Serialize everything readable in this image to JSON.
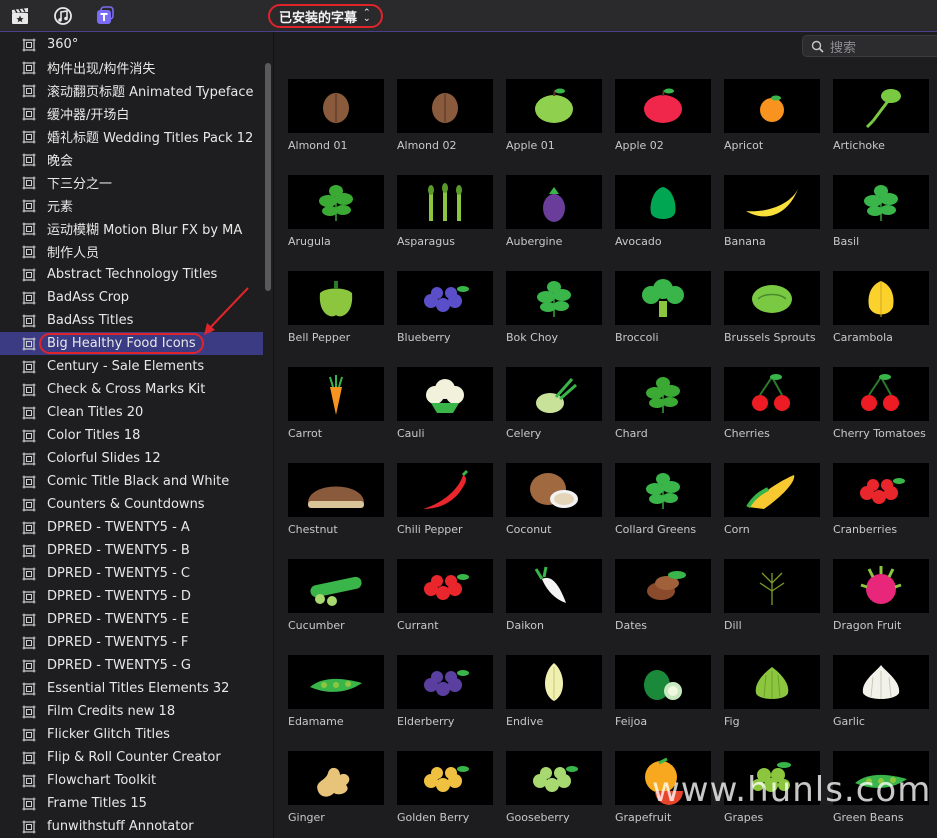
{
  "toolbar": {
    "icons": [
      "clapper-star-icon",
      "music-notes-icon",
      "titles-icon"
    ],
    "dropdown_label": "已安装的字幕",
    "accent": "#4a3f8a",
    "highlight_color": "#e0242a"
  },
  "search": {
    "placeholder": "搜索"
  },
  "sidebar": {
    "selected_index": 13,
    "items": [
      "360°",
      "构件出现/构件消失",
      "滚动翻页标题 Animated Typeface",
      "缓冲器/开场白",
      "婚礼标题 Wedding Titles Pack 12",
      "晚会",
      "下三分之一",
      "元素",
      "运动模糊 Motion Blur FX by MA",
      "制作人员",
      "Abstract Technology Titles",
      "BadAss Crop",
      "BadAss Titles",
      "Big Healthy Food Icons",
      "Century - Sale Elements",
      "Check & Cross Marks Kit",
      "Clean Titles 20",
      "Color Titles 18",
      "Colorful Slides 12",
      "Comic Title Black and White",
      "Counters & Countdowns",
      "DPRED - TWENTY5 - A",
      "DPRED - TWENTY5 - B",
      "DPRED - TWENTY5 - C",
      "DPRED - TWENTY5 - D",
      "DPRED - TWENTY5 - E",
      "DPRED - TWENTY5 - F",
      "DPRED - TWENTY5 - G",
      "Essential Titles Elements 32",
      "Film Credits new 18",
      "Flicker Glitch Titles",
      "Flip & Roll Counter Creator",
      "Flowchart Toolkit",
      "Frame Titles 15",
      "funwithstuff Annotator"
    ]
  },
  "tiles": [
    {
      "name": "Almond 01",
      "icon": "almond-icon",
      "color": "#8a5a3c"
    },
    {
      "name": "Almond 02",
      "icon": "almond-icon",
      "color": "#8a5a3c"
    },
    {
      "name": "Apple 01",
      "icon": "apple-icon",
      "color": "#8fd14f"
    },
    {
      "name": "Apple 02",
      "icon": "apple-icon",
      "color": "#f0264a"
    },
    {
      "name": "Apricot",
      "icon": "apricot-icon",
      "color": "#f7931e"
    },
    {
      "name": "Artichoke",
      "icon": "artichoke-icon",
      "color": "#7ac943"
    },
    {
      "name": "Arugula",
      "icon": "leafy-icon",
      "color": "#3aaa35"
    },
    {
      "name": "Asparagus",
      "icon": "asparagus-icon",
      "color": "#8cc63f"
    },
    {
      "name": "Aubergine",
      "icon": "aubergine-icon",
      "color": "#6a3d9a"
    },
    {
      "name": "Avocado",
      "icon": "avocado-icon",
      "color": "#00a651"
    },
    {
      "name": "Banana",
      "icon": "banana-icon",
      "color": "#f9e03a"
    },
    {
      "name": "Basil",
      "icon": "leafy-icon",
      "color": "#39b54a"
    },
    {
      "name": "Bell Pepper",
      "icon": "pepper-icon",
      "color": "#8cc63f"
    },
    {
      "name": "Blueberry",
      "icon": "berries-icon",
      "color": "#5b4fc9"
    },
    {
      "name": "Bok Choy",
      "icon": "leafy-icon",
      "color": "#39b54a"
    },
    {
      "name": "Broccoli",
      "icon": "broccoli-icon",
      "color": "#39b54a"
    },
    {
      "name": "Brussels Sprouts",
      "icon": "sprout-icon",
      "color": "#7ac943"
    },
    {
      "name": "Carambola",
      "icon": "carambola-icon",
      "color": "#fbd12c"
    },
    {
      "name": "Carrot",
      "icon": "carrot-icon",
      "color": "#f7931e"
    },
    {
      "name": "Cauli",
      "icon": "cauliflower-icon",
      "color": "#f2f2dc"
    },
    {
      "name": "Celery",
      "icon": "celery-icon",
      "color": "#c9e29a"
    },
    {
      "name": "Chard",
      "icon": "leafy-icon",
      "color": "#3aaa35"
    },
    {
      "name": "Cherries",
      "icon": "cherries-icon",
      "color": "#ed1c24"
    },
    {
      "name": "Cherry Tomatoes",
      "icon": "cherries-icon",
      "color": "#ed1c24"
    },
    {
      "name": "Chestnut",
      "icon": "chestnut-icon",
      "color": "#8a5a3c"
    },
    {
      "name": "Chili Pepper",
      "icon": "chili-icon",
      "color": "#e8262c"
    },
    {
      "name": "Coconut",
      "icon": "coconut-icon",
      "color": "#a0693f"
    },
    {
      "name": "Collard Greens",
      "icon": "leafy-icon",
      "color": "#39b54a"
    },
    {
      "name": "Corn",
      "icon": "corn-icon",
      "color": "#f7c82f"
    },
    {
      "name": "Cranberries",
      "icon": "berries-icon",
      "color": "#e8262c"
    },
    {
      "name": "Cucumber",
      "icon": "cucumber-icon",
      "color": "#39b54a"
    },
    {
      "name": "Currant",
      "icon": "berries-icon",
      "color": "#e8262c"
    },
    {
      "name": "Daikon",
      "icon": "daikon-icon",
      "color": "#f4f4f4"
    },
    {
      "name": "Dates",
      "icon": "dates-icon",
      "color": "#8a4a2c"
    },
    {
      "name": "Dill",
      "icon": "dill-icon",
      "color": "#7a9a2c"
    },
    {
      "name": "Dragon Fruit",
      "icon": "dragonfruit-icon",
      "color": "#e8267a"
    },
    {
      "name": "Edamame",
      "icon": "pod-icon",
      "color": "#39b54a"
    },
    {
      "name": "Elderberry",
      "icon": "berries-icon",
      "color": "#5b3fa0"
    },
    {
      "name": "Endive",
      "icon": "endive-icon",
      "color": "#f0f0b0"
    },
    {
      "name": "Feijoa",
      "icon": "feijoa-icon",
      "color": "#1a8a3a"
    },
    {
      "name": "Fig",
      "icon": "fig-icon",
      "color": "#8cc63f"
    },
    {
      "name": "Garlic",
      "icon": "garlic-icon",
      "color": "#f2f2ea"
    },
    {
      "name": "Ginger",
      "icon": "ginger-icon",
      "color": "#e8c37a"
    },
    {
      "name": "Golden Berry",
      "icon": "berries-icon",
      "color": "#f0c040"
    },
    {
      "name": "Gooseberry",
      "icon": "berries-icon",
      "color": "#a8d870"
    },
    {
      "name": "Grapefruit",
      "icon": "grapefruit-icon",
      "color": "#f7a81e"
    },
    {
      "name": "Grapes",
      "icon": "grapes-icon",
      "color": "#8cc63f"
    },
    {
      "name": "Green Beans",
      "icon": "pod-icon",
      "color": "#39b54a"
    }
  ],
  "watermark": "www.hunls.com"
}
